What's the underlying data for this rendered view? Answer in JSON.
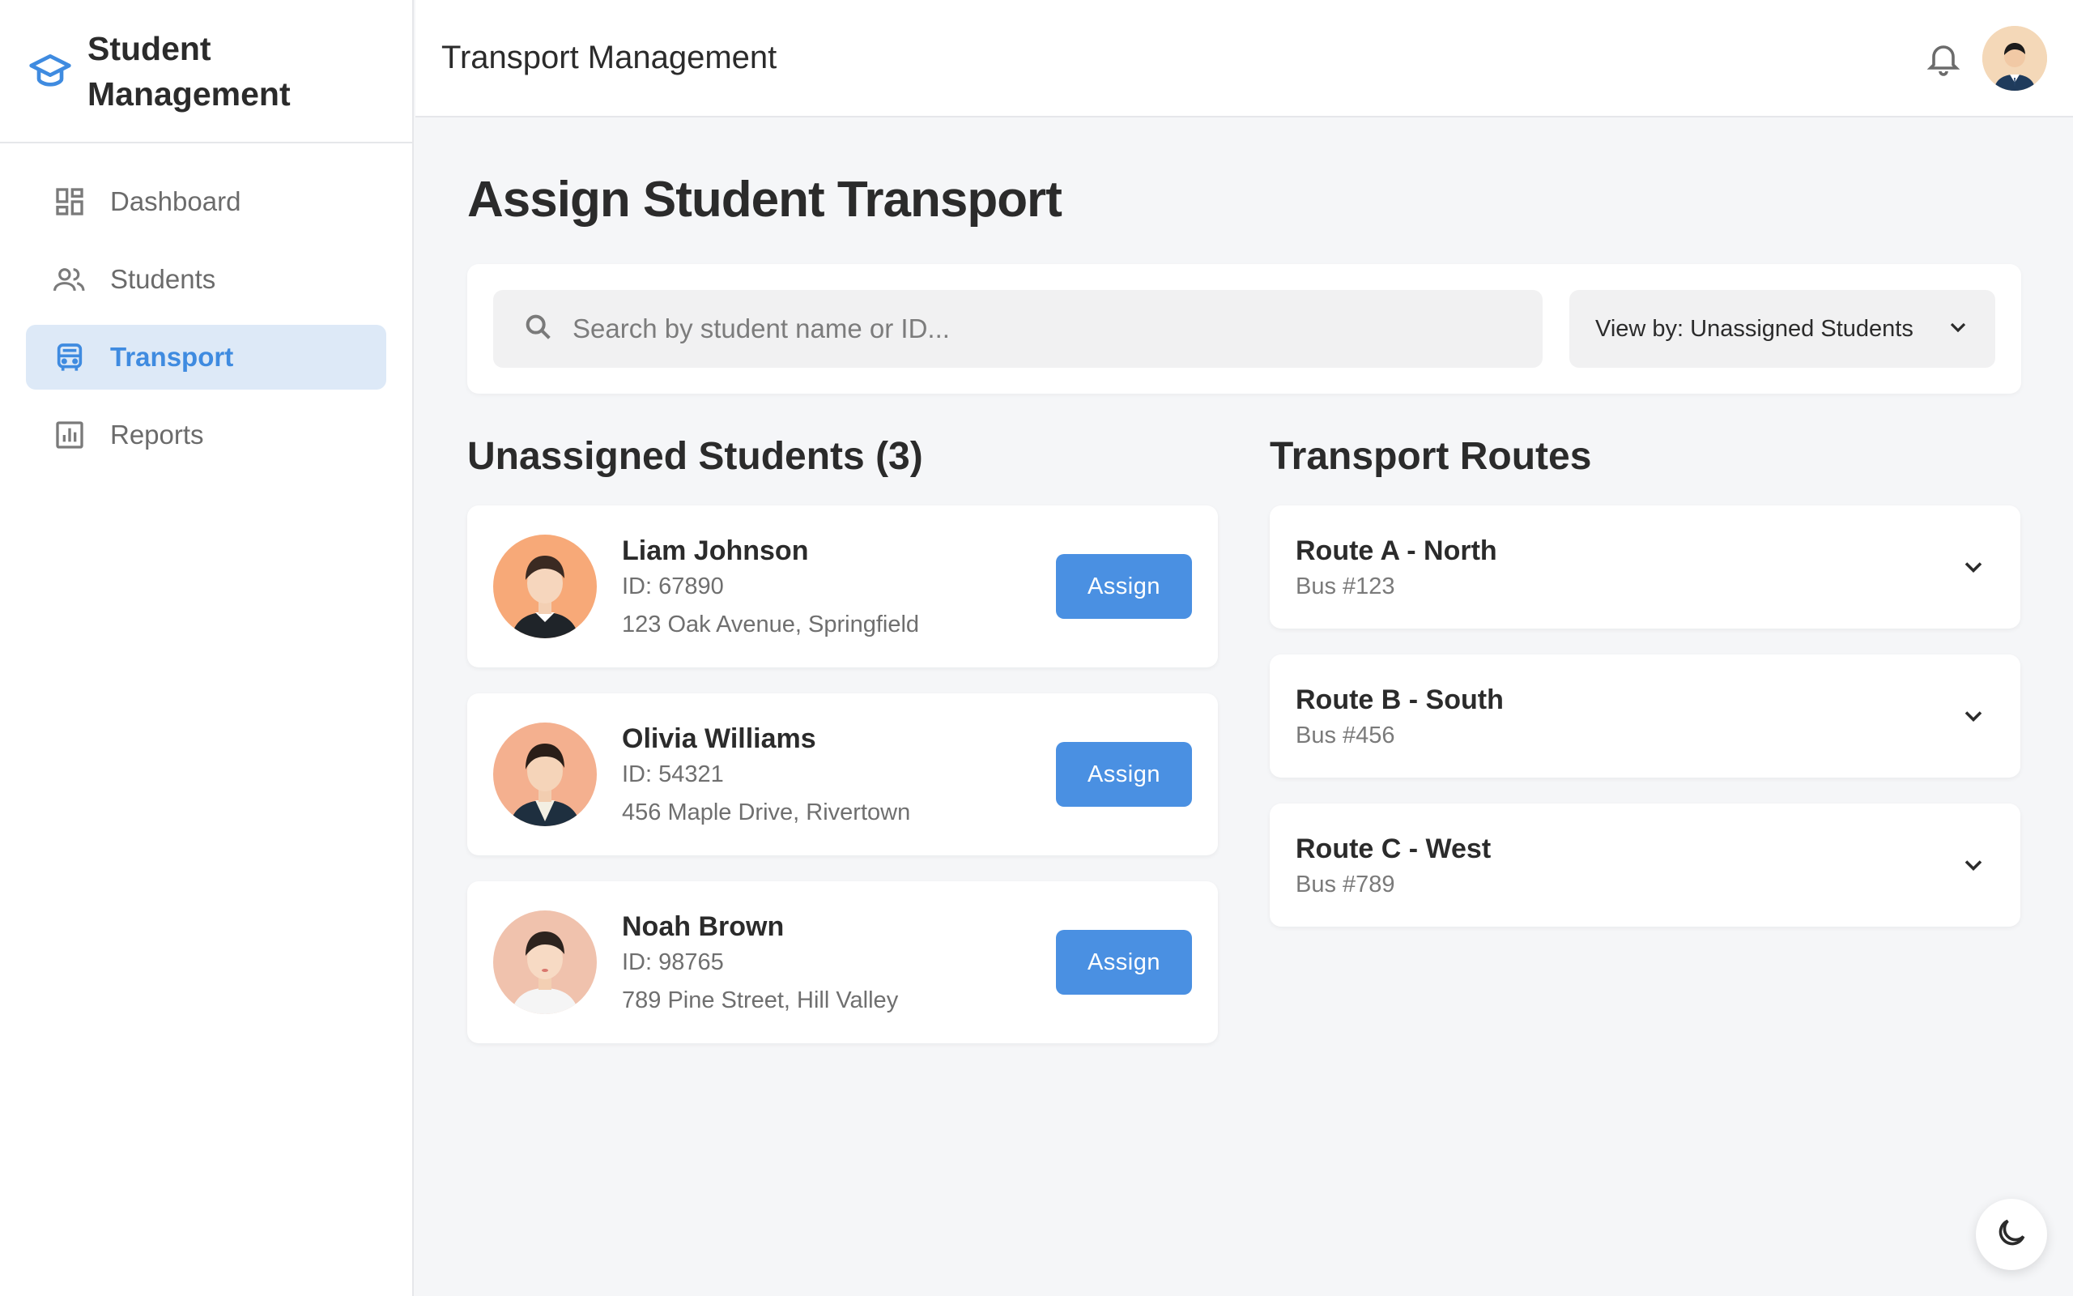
{
  "brand": {
    "title": "Student Management",
    "icon": "graduation-cap-icon"
  },
  "sidebar": {
    "items": [
      {
        "label": "Dashboard",
        "icon": "dashboard-icon",
        "active": false
      },
      {
        "label": "Students",
        "icon": "users-icon",
        "active": false
      },
      {
        "label": "Transport",
        "icon": "bus-icon",
        "active": true
      },
      {
        "label": "Reports",
        "icon": "bar-chart-icon",
        "active": false
      }
    ]
  },
  "header": {
    "title": "Transport Management"
  },
  "page": {
    "title": "Assign Student Transport"
  },
  "search": {
    "placeholder": "Search by student name or ID...",
    "value": ""
  },
  "view_select": {
    "label": "View by: Unassigned Students"
  },
  "unassigned": {
    "title": "Unassigned Students (3)",
    "students": [
      {
        "name": "Liam Johnson",
        "id": "ID: 67890",
        "address": "123 Oak Avenue, Springfield",
        "button": "Assign"
      },
      {
        "name": "Olivia Williams",
        "id": "ID: 54321",
        "address": "456 Maple Drive, Rivertown",
        "button": "Assign"
      },
      {
        "name": "Noah Brown",
        "id": "ID: 98765",
        "address": "789 Pine Street, Hill Valley",
        "button": "Assign"
      }
    ]
  },
  "routes": {
    "title": "Transport Routes",
    "items": [
      {
        "name": "Route A - North",
        "bus": "Bus #123"
      },
      {
        "name": "Route B - South",
        "bus": "Bus #456"
      },
      {
        "name": "Route C - West",
        "bus": "Bus #789"
      }
    ]
  },
  "colors": {
    "accent": "#4a90e2",
    "active_bg": "#dde9f7",
    "background": "#f5f6f8"
  }
}
